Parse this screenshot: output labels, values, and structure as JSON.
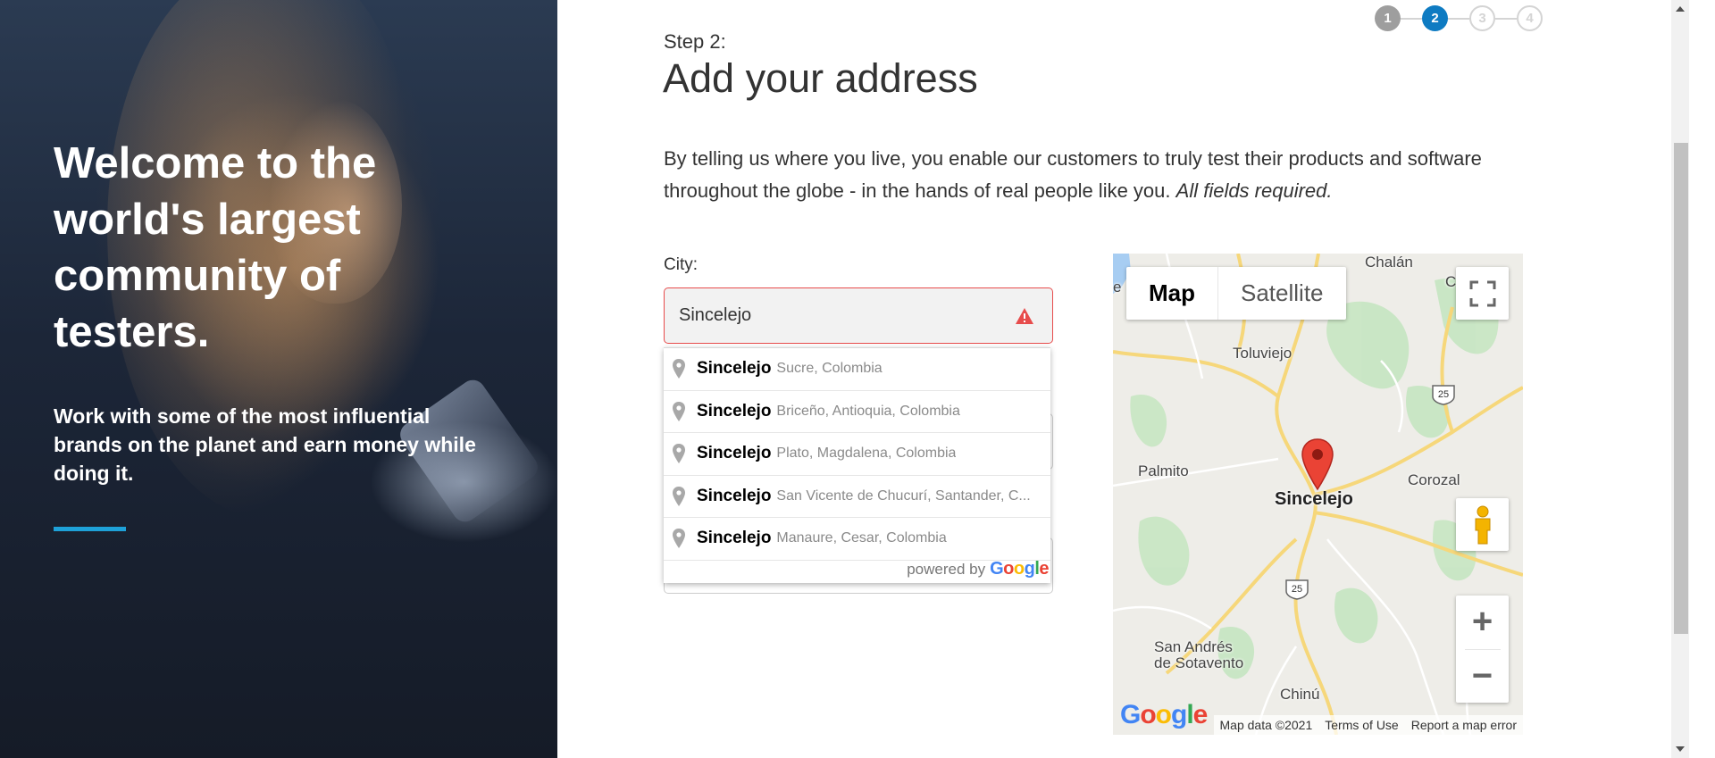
{
  "hero": {
    "title": "Welcome to the world's largest community of testers.",
    "subtitle": "Work with some of the most influential brands on the planet and earn money while doing it.",
    "accent_color": "#1ea1d8"
  },
  "stepper": {
    "steps": [
      "1",
      "2",
      "3",
      "4"
    ],
    "current": 2,
    "active_color": "#0e7bc2"
  },
  "form": {
    "step_label": "Step 2:",
    "title": "Add your address",
    "intro": "By telling us where you live, you enable our customers to truly test their products and software throughout the globe - in the hands of real people like you.",
    "intro_emphasis": "All fields required.",
    "city_label": "City:",
    "city_value": "Sincelejo",
    "error_color": "#e74c4c"
  },
  "autocomplete": {
    "suggestions": [
      {
        "main": "Sincelejo",
        "secondary": "Sucre, Colombia"
      },
      {
        "main": "Sincelejo",
        "secondary": "Briceño, Antioquia, Colombia"
      },
      {
        "main": "Sincelejo",
        "secondary": "Plato, Magdalena, Colombia"
      },
      {
        "main": "Sincelejo",
        "secondary": "San Vicente de Chucurí, Santander, C..."
      },
      {
        "main": "Sincelejo",
        "secondary": "Manaure, Cesar, Colombia"
      }
    ],
    "powered_by": "powered by",
    "google_word": "Google"
  },
  "map": {
    "type_map": "Map",
    "type_satellite": "Satellite",
    "zoom_in": "+",
    "zoom_out": "−",
    "labels": {
      "chalan": "Chalán",
      "toluviejo": "Toluviejo",
      "palmito": "Palmito",
      "corozal": "Corozal",
      "sincelejo": "Sincelejo",
      "san_andres": "San Andrés",
      "de_sotavento": "de Sotavento",
      "chinu": "Chinú",
      "road_25_a": "25",
      "road_25_b": "25",
      "edge_c": "C",
      "edge_e": "e"
    },
    "attribution": {
      "data": "Map data ©2021",
      "terms": "Terms of Use",
      "report": "Report a map error"
    },
    "google_logo": "Google"
  }
}
